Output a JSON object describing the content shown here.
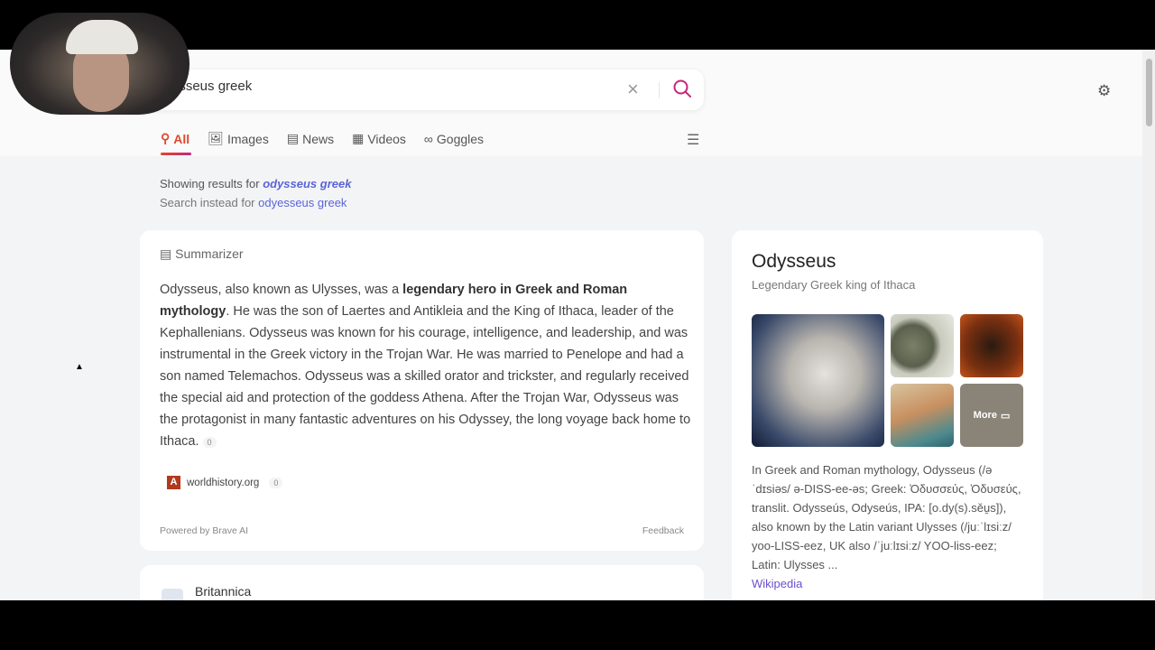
{
  "search": {
    "query": "odysseus greek",
    "visible_query": "esseus greek"
  },
  "tabs": [
    {
      "label": "All",
      "icon": "search-icon"
    },
    {
      "label": "Images",
      "icon": "image-icon"
    },
    {
      "label": "News",
      "icon": "news-icon"
    },
    {
      "label": "Videos",
      "icon": "film-icon"
    },
    {
      "label": "Goggles",
      "icon": "goggles-icon"
    }
  ],
  "correction": {
    "showing_prefix": "Showing results for",
    "showing_term": "odysseus greek",
    "instead_prefix": "Search instead for",
    "instead_term": "odyesseus greek"
  },
  "summarizer": {
    "title": "Summarizer",
    "text_1": "Odysseus, also known as Ulysses, was a ",
    "bold": "legendary hero in Greek and Roman mythology",
    "text_2": ". He was the son of Laertes and Antikleia and the King of Ithaca, leader of the Kephallenians. Odysseus was known for his courage, intelligence, and leadership, and was instrumental in the Greek victory in the Trojan War. He was married to Penelope and had a son named Telemachos. Odysseus was a skilled orator and trickster, and regularly received the special aid and protection of the goddess Athena. After the Trojan War, Odysseus was the protagonist in many fantastic adventures on his Odyssey, the long voyage back home to Ithaca.",
    "cite_count": "0",
    "source": {
      "name": "worldhistory.org",
      "count": "0",
      "favicon_letter": "A"
    },
    "powered_by": "Powered by Brave AI",
    "feedback": "Feedback"
  },
  "next_result": {
    "site": "Britannica"
  },
  "knowledge_panel": {
    "title": "Odysseus",
    "subtitle": "Legendary Greek king of Ithaca",
    "more_label": "More",
    "description": "In Greek and Roman mythology, Odysseus (/ə ˈdɪsiəs/ ə-DISS-ee-əs; Greek: Ὀδυσσεύς, Ὀδυσεύς, translit. Odysseús, Odyseús, IPA: [o.dy(s).sěu̯s]), also known by the Latin variant Ulysses (/juːˈlɪsiːz/ yoo-LISS-eez, UK also /ˈjuːlɪsiːz/ YOO-liss-eez; Latin: Ulysses ...",
    "source": "Wikipedia"
  },
  "colors": {
    "accent": "#e0482f",
    "link": "#5a64d8",
    "search_icon": "#c7257a"
  }
}
